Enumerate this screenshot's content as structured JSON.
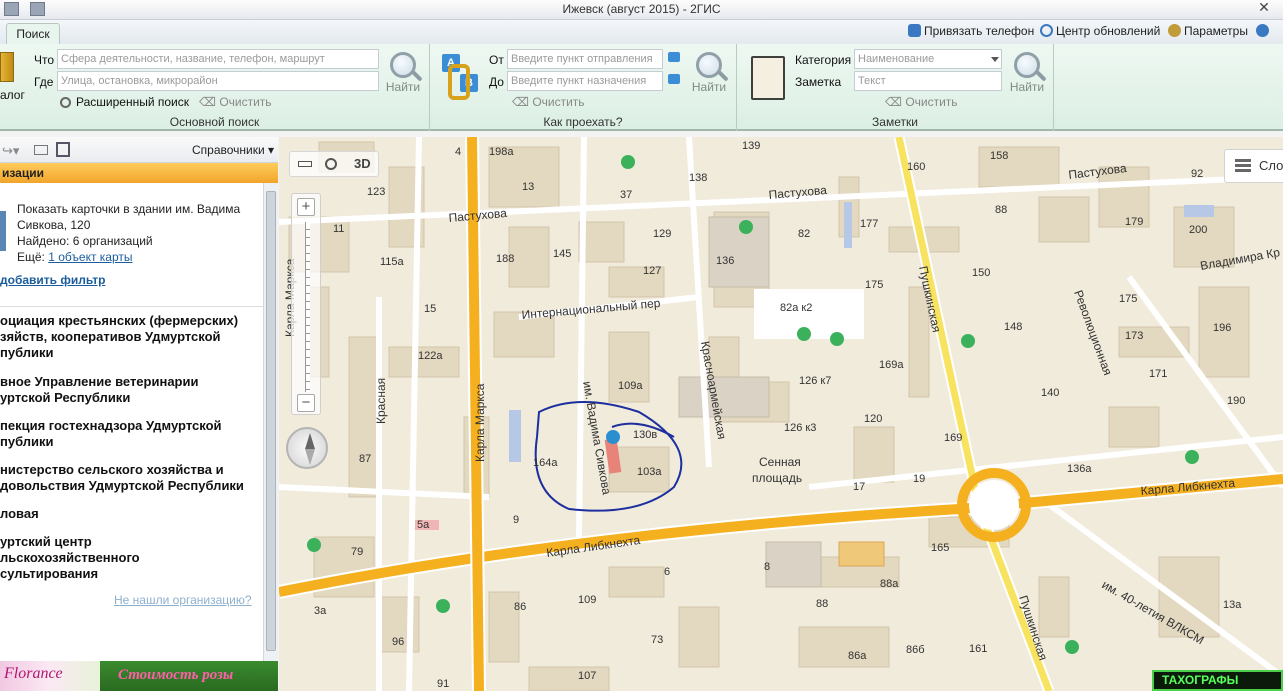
{
  "window": {
    "title": "Ижевск (август 2015) - 2ГИС",
    "close": "✕"
  },
  "tabs": {
    "search": "Поиск"
  },
  "topbar": {
    "bind_phone": "Привязать телефон",
    "update_center": "Центр обновлений",
    "params": "Параметры"
  },
  "ribbon": {
    "main_search": {
      "what_label": "Что",
      "what_placeholder": "Сфера деятельности, название, телефон, маршрут",
      "where_label": "Где",
      "where_placeholder": "Улица, остановка, микрорайон",
      "advanced": "Расширенный поиск",
      "clear": "Очистить",
      "find": "Найти",
      "caption": "Основной поиск",
      "catalog_label": "алог"
    },
    "route": {
      "from_label": "От",
      "from_placeholder": "Введите пункт отправления",
      "to_label": "До",
      "to_placeholder": "Введите пункт назначения",
      "clear": "Очистить",
      "find": "Найти",
      "caption": "Как проехать?"
    },
    "notes": {
      "category_label": "Категория",
      "category_placeholder": "Наименование",
      "note_label": "Заметка",
      "note_placeholder": "Текст",
      "clear": "Очистить",
      "find": "Найти",
      "caption": "Заметки"
    }
  },
  "left_panel": {
    "toolbar_dropdown": "Справочники",
    "header": "изации",
    "info": {
      "line1": "Показать карточки в здании им. Вадима",
      "line2": "Сивкова, 120",
      "found": "Найдено: 6 организаций",
      "more_prefix": "Ещё:",
      "more_link": "1 объект карты"
    },
    "add_filter": "добавить фильтр",
    "organizations": [
      {
        "l1": "оциация крестьянских (фермерских)",
        "l2": "зяйств, кооперативов Удмуртской",
        "l3": "публики"
      },
      {
        "l1": "вное Управление ветеринарии",
        "l2": "уртской Республики",
        "l3": ""
      },
      {
        "l1": "пекция гостехнадзора Удмуртской",
        "l2": "публики",
        "l3": ""
      },
      {
        "l1": "нистерство сельского хозяйства и",
        "l2": "довольствия Удмуртской Республики",
        "l3": ""
      },
      {
        "l1": "ловая",
        "l2": "",
        "l3": ""
      },
      {
        "l1": "уртский центр",
        "l2": "льскохозяйственного",
        "l3": "сультирования"
      }
    ],
    "not_found": "Не нашли организацию?"
  },
  "banner": {
    "left": "Florance",
    "right": "Стоимость розы"
  },
  "map": {
    "view3d": "3D",
    "zoom_in": "+",
    "zoom_out": "−",
    "layers": "Слои",
    "ad": "ТАХОГРАФЫ",
    "streets": {
      "pastukhova_left": "Пастухова",
      "pastukhova_right": "Пастухова",
      "pastukhova_far": "Пастухова",
      "internatsionalny": "Интернациональный пер",
      "karla_marksa": "Карла Маркса",
      "krasnaya": "Красная",
      "vadima_sivkova": "им. Вадима Сивкова",
      "krasnoarmeyskaya": "Красноармейская",
      "pushkinskaya_top": "Пушкинская",
      "pushkinskaya_bottom": "Пушкинская",
      "revolyutsionnaya": "Революционная",
      "karla_libknekhta_left": "Карла Либкнехта",
      "karla_libknekhta_right": "Карла Либкнехта",
      "vladimira": "Владимира Кр",
      "vlksm": "им. 40-летия ВЛКСМ",
      "karla_marksa_left": "Карла Маркса",
      "sennaya": "Сенная",
      "ploshchad": "площадь"
    },
    "numbers": {
      "n198a": "198а",
      "n4": "4",
      "n13": "13",
      "n123": "123",
      "n11": "11",
      "n115a": "115а",
      "n188": "188",
      "n145": "145",
      "n37": "37",
      "n129": "129",
      "n127": "127",
      "n138": "138",
      "n139": "139",
      "n136": "136",
      "n82": "82",
      "n177": "177",
      "n160": "160",
      "n158": "158",
      "n92": "92",
      "n88top": "88",
      "n179": "179",
      "n200": "200",
      "n150": "150",
      "n175a": "175",
      "n175b": "175",
      "n82ak2": "82а к2",
      "n148": "148",
      "n173": "173",
      "n196": "196",
      "n15": "15",
      "n122a": "122а",
      "n109a": "109а",
      "n126k7": "126 к7",
      "n169a": "169а",
      "n171": "171",
      "n140": "140",
      "n190": "190",
      "n130v": "130в",
      "n126k3": "126 к3",
      "n120": "120",
      "n169": "169",
      "n136a": "136а",
      "n87": "87",
      "n164a": "164а",
      "n103a": "103а",
      "n17": "17",
      "n19": "19",
      "n9": "9",
      "n5a": "5а",
      "n79": "79",
      "n6": "6",
      "n165": "165",
      "n8": "8",
      "n88a": "88а",
      "n88": "88",
      "n3a": "3а",
      "n86": "86",
      "n109": "109",
      "n96": "96",
      "n73": "73",
      "n86a": "86а",
      "n86b": "86б",
      "n161": "161",
      "n13a": "13а",
      "n107": "107",
      "n91": "91"
    }
  }
}
